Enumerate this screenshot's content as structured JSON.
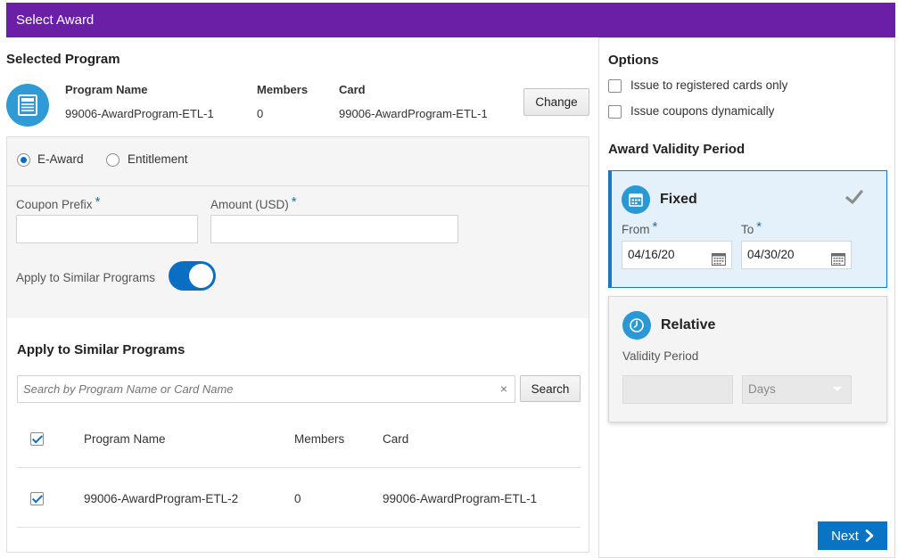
{
  "window": {
    "title": "Select Award"
  },
  "selected_program": {
    "heading": "Selected Program",
    "icon": "program-document-icon",
    "columns": {
      "name": "Program Name",
      "members": "Members",
      "card": "Card"
    },
    "values": {
      "name": "99006-AwardProgram-ETL-1",
      "members": "0",
      "card": "99006-AwardProgram-ETL-1"
    },
    "change_label": "Change"
  },
  "award_type": {
    "options": [
      {
        "label": "E-Award",
        "selected": true
      },
      {
        "label": "Entitlement",
        "selected": false
      }
    ]
  },
  "coupon": {
    "prefix_label": "Coupon Prefix",
    "prefix_value": "",
    "amount_label": "Amount (USD)",
    "amount_value": "",
    "required_mark": "*",
    "apply_similar_label": "Apply to Similar Programs",
    "apply_similar_on": true
  },
  "similar": {
    "heading": "Apply to Similar Programs",
    "search_placeholder": "Search by Program Name or Card Name",
    "clear_glyph": "×",
    "search_label": "Search",
    "columns": {
      "name": "Program Name",
      "members": "Members",
      "card": "Card"
    },
    "header_checked": true,
    "rows": [
      {
        "checked": true,
        "name": "99006-AwardProgram-ETL-2",
        "members": "0",
        "card": "99006-AwardProgram-ETL-1"
      }
    ]
  },
  "options": {
    "heading": "Options",
    "items": [
      {
        "label": "Issue to registered cards only",
        "checked": false
      },
      {
        "label": "Issue coupons dynamically",
        "checked": false
      }
    ]
  },
  "validity": {
    "heading": "Award Validity Period",
    "fixed": {
      "title": "Fixed",
      "selected": true,
      "from_label": "From",
      "from_value": "04/16/20",
      "to_label": "To",
      "to_value": "04/30/20"
    },
    "relative": {
      "title": "Relative",
      "period_label": "Validity Period",
      "period_value": "",
      "unit_value": "Days"
    }
  },
  "footer": {
    "next_label": "Next"
  },
  "colors": {
    "title_bar": "#6a1fa6",
    "accent": "#0a74c4",
    "icon_blue": "#2a98d4"
  }
}
